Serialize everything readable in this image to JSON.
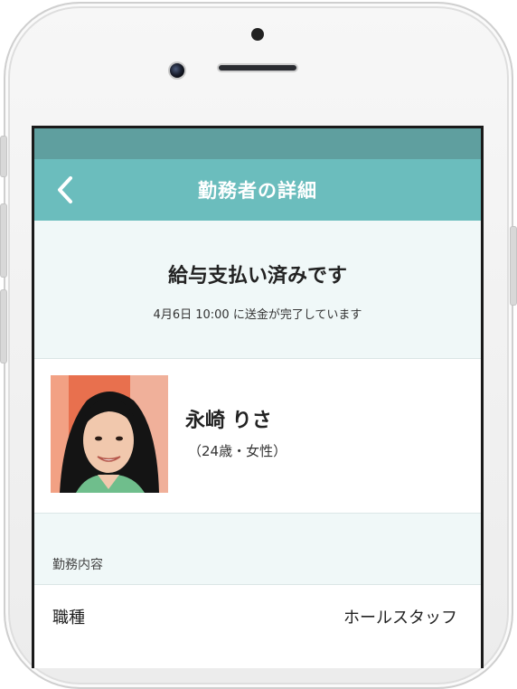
{
  "nav": {
    "title": "勤務者の詳細",
    "back_icon": "chevron-left-icon"
  },
  "status": {
    "title": "給与支払い済みです",
    "subtitle": "4月6日 10:00 に送金が完了しています"
  },
  "profile": {
    "name": "永崎 りさ",
    "meta": "（24歳・女性）"
  },
  "work_section": {
    "header": "勤務内容",
    "rows": [
      {
        "label": "職種",
        "value": "ホールスタッフ"
      }
    ]
  },
  "colors": {
    "nav_bar": "#6bbdbd",
    "status_bar": "#5f9f9f",
    "section_bg": "#f0f8f8"
  }
}
